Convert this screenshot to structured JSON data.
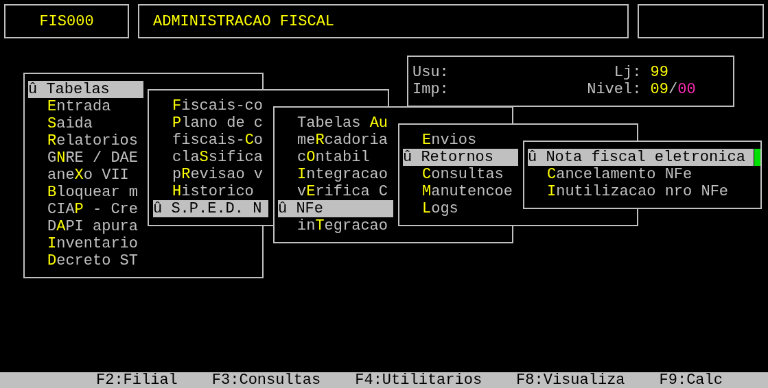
{
  "header": {
    "code": "FIS000",
    "title": "ADMINISTRACAO FISCAL"
  },
  "info": {
    "user_label": "Usu:",
    "printer_label": "Imp:",
    "store_label": "Lj:",
    "store_value": "99",
    "level_label": "Nivel:",
    "level_value": "09",
    "level_separator": "/",
    "level_value_2": "00"
  },
  "menus": [
    {
      "items": [
        {
          "text": "û Tabelas",
          "selected": true
        },
        {
          "key": "E",
          "after": "ntrada",
          "selected": false
        },
        {
          "key": "S",
          "after": "aida",
          "selected": false
        },
        {
          "key": "R",
          "after": "elatorios",
          "selected": false
        },
        {
          "before": "G",
          "key": "N",
          "after": "RE / DAE",
          "selected": false
        },
        {
          "before": "ane",
          "key": "X",
          "after": "o VII",
          "selected": false
        },
        {
          "key": "B",
          "after": "loquear m",
          "selected": false
        },
        {
          "before": "CIA",
          "key": "P",
          "after": " - Cre",
          "selected": false
        },
        {
          "before": "D",
          "key": "A",
          "after": "PI apura",
          "selected": false
        },
        {
          "key": "I",
          "after": "nventario",
          "selected": false
        },
        {
          "key": "D",
          "after": "ecreto ST",
          "selected": false
        }
      ]
    },
    {
      "items": [
        {
          "key": "F",
          "after": "iscais-co",
          "selected": false
        },
        {
          "key": "P",
          "after": "lano de c",
          "selected": false
        },
        {
          "before": "fiscais-",
          "key": "C",
          "after": "o",
          "selected": false
        },
        {
          "before": "cla",
          "key": "S",
          "after": "sifica",
          "selected": false
        },
        {
          "before": "p",
          "key": "R",
          "after": "evisao v",
          "selected": false
        },
        {
          "key": "H",
          "after": "istorico",
          "selected": false
        },
        {
          "text": "û S.P.E.D. N",
          "selected": true
        }
      ]
    },
    {
      "items": [
        {
          "before": "Tabelas ",
          "key": "Au",
          "selected": false
        },
        {
          "before": "me",
          "key": "R",
          "after": "cadoria",
          "selected": false
        },
        {
          "before": "c",
          "key": "O",
          "after": "ntabil",
          "selected": false
        },
        {
          "key": "I",
          "after": "ntegracao",
          "selected": false
        },
        {
          "before": "v",
          "key": "E",
          "after": "rifica C",
          "selected": false
        },
        {
          "text": "û NFe",
          "selected": true
        },
        {
          "before": "in",
          "key": "T",
          "after": "egracao",
          "selected": false
        }
      ]
    },
    {
      "items": [
        {
          "key": "E",
          "after": "nvios",
          "selected": false
        },
        {
          "text": "û Retornos",
          "selected": true
        },
        {
          "key": "C",
          "after": "onsultas",
          "selected": false
        },
        {
          "key": "M",
          "after": "anutencoe",
          "selected": false
        },
        {
          "key": "L",
          "after": "ogs",
          "selected": false
        }
      ]
    },
    {
      "items": [
        {
          "text": "û Nota fiscal eletronica",
          "selected": true
        },
        {
          "key": "C",
          "after": "ancelamento NFe",
          "selected": false
        },
        {
          "key": "I",
          "after": "nutilizacao nro NFe",
          "selected": false
        }
      ]
    }
  ],
  "function_keys": [
    "F2:Filial",
    "F3:Consultas",
    "F4:Utilitarios",
    "F8:Visualiza",
    "F9:Calc"
  ]
}
